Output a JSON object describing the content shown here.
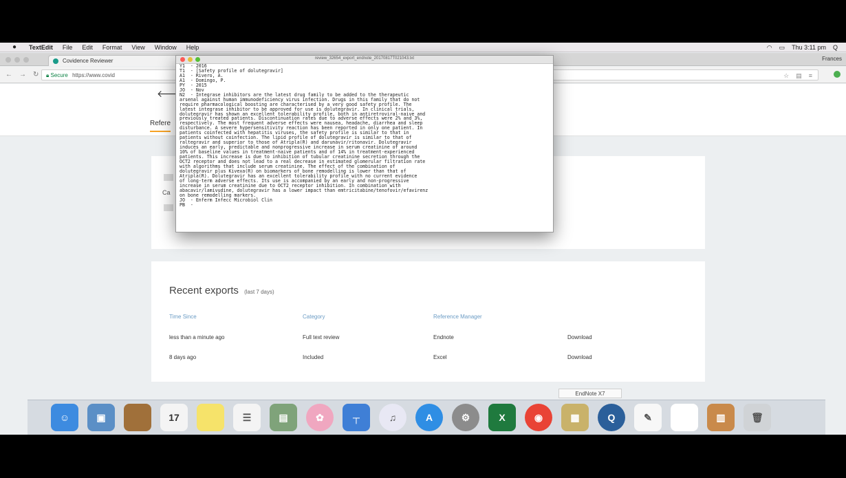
{
  "menubar": {
    "app_name": "TextEdit",
    "items": [
      "File",
      "Edit",
      "Format",
      "View",
      "Window",
      "Help"
    ],
    "clock": "Thu 3:11 pm",
    "user": "Q"
  },
  "browser": {
    "tab_title": "Covidence Reviewer",
    "profile": "Frances",
    "secure_label": "Secure",
    "url": "https://www.covid"
  },
  "page": {
    "tab_label": "Refere",
    "card1_label": "Ca"
  },
  "textedit": {
    "filename": "review_32654_export_endnote_20170817T021043.txt",
    "lines": [
      "Y1  - 2016",
      "T1  - [Safety profile of dolutegravir]",
      "A1  - Rivero, A.",
      "A1  - Domingo, P.",
      "PY  - 2015",
      "JO  - Nov",
      "N2  - Integrase inhibitors are the latest drug family to be added to the therapeutic",
      "arsenal against human immunodeficiency virus infection. Drugs in this family that do not",
      "require pharmacological boosting are characterised by a very good safety profile. The",
      "latest integrase inhibitor to be approved for use is dolutegravir. In clinical trials,",
      "dolutegravir has shown an excellent tolerability profile, both in antiretroviral-naive and",
      "previously treated patients. Discontinuation rates due to adverse effects were 2% and 3%,",
      "respectively. The most frequent adverse effects were nausea, headache, diarrhea and sleep",
      "disturbance. A severe hypersensitivity reaction has been reported in only one patient. In",
      "patients coinfected with hepatitis viruses, the safety profile is similar to that in",
      "patients without coinfection. The lipid profile of dolutegravir is similar to that of",
      "raltegravir and superior to those of Atripla(R) and darunavir/ritonavir. Dolutegravir",
      "induces an early, predictable and nonprogressive increase in serum creatinine of around",
      "10% of baseline values in treatment-naive patients and of 14% in treatment-experienced",
      "patients. This increase is due to inhibition of tubular creatinine secretion through the",
      "OCT2 receptor and does not lead to a real decrease in estimated glomerular filtration rate",
      "with algorithms that include serum creatinine. The effect of the combination of",
      "dolutegravir plus Kivexa(R) on biomarkers of bone remodelling is lower than that of",
      "Atripla(R). Dolutegravir has an excellent tolerability profile with no current evidence",
      "of long-term adverse effects. Its use is accompanied by an early and non-progressive",
      "increase in serum creatinine due to OCT2 receptor inhibition. In combination with",
      "abacavir/lamivudine, dolutegravir has a lower impact than emtricitabine/tenofovir/efavirenz",
      "on bone remodelling markers.",
      "JO  - Enferm Infecc Microbiol Clin",
      "PB  - "
    ]
  },
  "recent_exports": {
    "title": "Recent exports",
    "subtitle": "(last 7 days)",
    "columns": [
      "Time Since",
      "Category",
      "Reference Manager"
    ],
    "rows": [
      {
        "time": "less than a minute ago",
        "category": "Full text review",
        "manager": "Endnote",
        "action": "Download"
      },
      {
        "time": "8 days ago",
        "category": "Included",
        "manager": "Excel",
        "action": "Download"
      }
    ]
  },
  "endnote_button": "EndNote X7",
  "dock": {
    "icons": [
      "finder-icon",
      "preview-icon",
      "notes-book-icon",
      "calendar-icon",
      "stickies-icon",
      "reminders-icon",
      "photo-booth-icon",
      "photos-icon",
      "keynote-icon",
      "itunes-icon",
      "app-store-icon",
      "system-preferences-icon",
      "excel-icon",
      "chrome-icon",
      "image-capture-icon",
      "quicktime-icon",
      "textedit-icon",
      "document-icon",
      "books-icon",
      "trash-icon"
    ],
    "calendar_date": "17"
  }
}
